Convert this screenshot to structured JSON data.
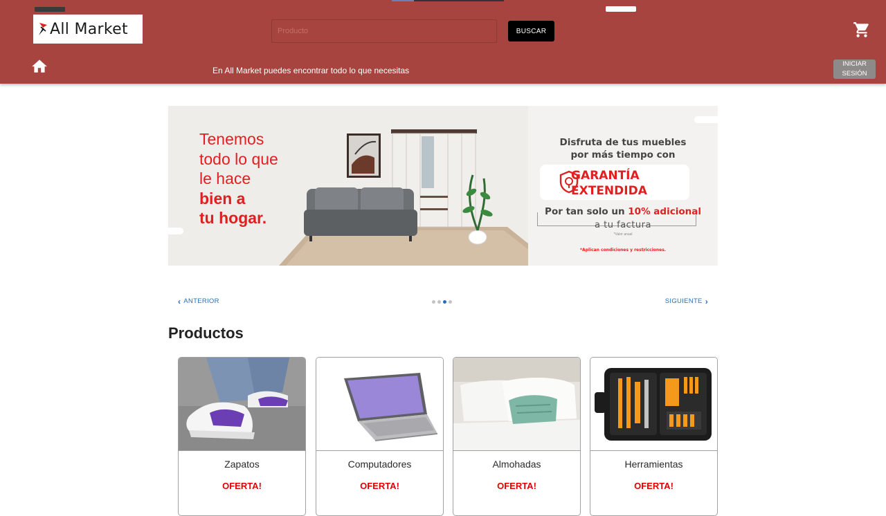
{
  "header": {
    "logo_text": "All Market",
    "search": {
      "placeholder": "Producto",
      "value": ""
    },
    "search_button_label": "BUSCAR",
    "tagline": "En All Market puedes encontrar todo lo que necesitas",
    "login_button_label": "INICIAR\nSESIÓN",
    "cart_icon": "cart-icon",
    "home_icon": "home-icon"
  },
  "banner": {
    "left_lines": [
      "Tenemos",
      "todo lo que",
      "le hace"
    ],
    "left_bold_lines": [
      "bien a",
      "tu hogar."
    ],
    "right_heading_1": "Disfruta de tus muebles",
    "right_heading_2": "por más tiempo con",
    "garantia_1": "GARANTÍA",
    "garantia_2": "EXTENDIDA",
    "price_prefix": "Por tan solo un ",
    "price_highlight": "10% adicional",
    "price_sub": "a tu factura",
    "price_tiny": "*Valor anual",
    "conditions": "*Aplican condiciones y restricciones."
  },
  "carousel": {
    "prev_label": "ANTERIOR",
    "next_label": "SIGUIENTE",
    "slide_count": 4,
    "active_index": 2
  },
  "products": {
    "title": "Productos",
    "items": [
      {
        "name": "Zapatos",
        "badge": "OFERTA!"
      },
      {
        "name": "Computadores",
        "badge": "OFERTA!"
      },
      {
        "name": "Almohadas",
        "badge": "OFERTA!"
      },
      {
        "name": "Herramientas",
        "badge": "OFERTA!"
      }
    ]
  },
  "colors": {
    "header_bg": "#a8443f",
    "accent_red": "#e02020",
    "link_blue": "#2a6db5",
    "offer_red": "#e00000"
  }
}
